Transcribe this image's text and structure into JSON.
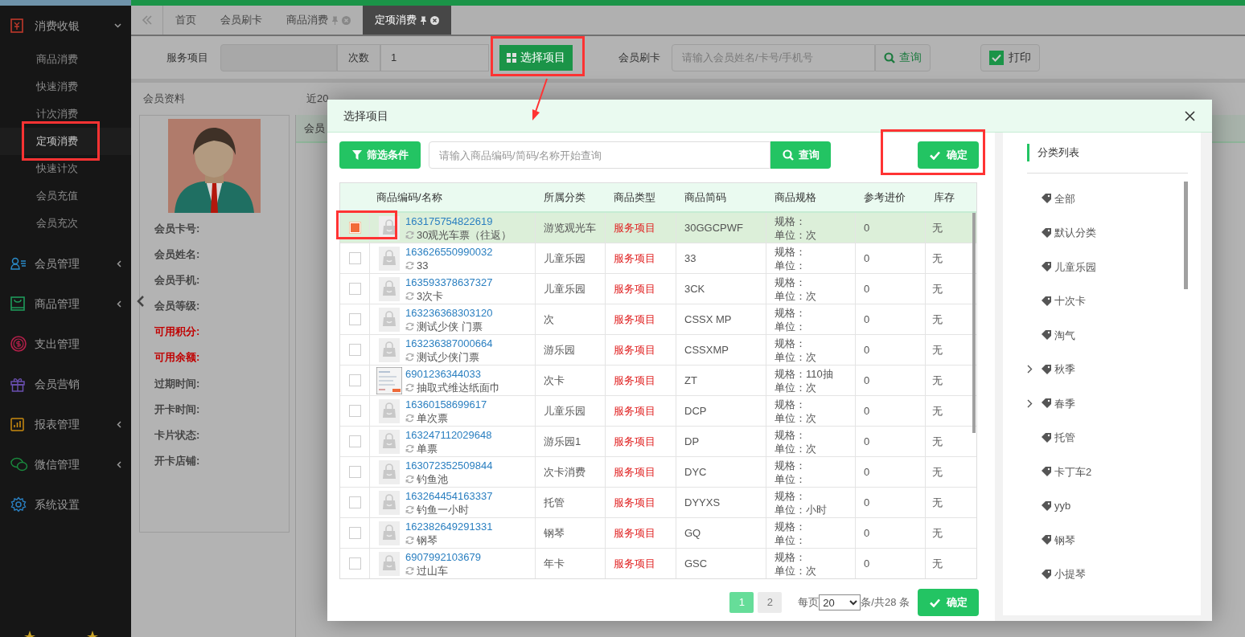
{
  "sidebar": {
    "menu": [
      {
        "label": "消费收银",
        "expanded": true,
        "children": [
          {
            "label": "商品消费",
            "selected": false
          },
          {
            "label": "快速消费",
            "selected": false
          },
          {
            "label": "计次消费",
            "selected": false
          },
          {
            "label": "定项消费",
            "selected": true
          },
          {
            "label": "快速计次",
            "selected": false
          },
          {
            "label": "会员充值",
            "selected": false
          },
          {
            "label": "会员充次",
            "selected": false
          }
        ]
      },
      {
        "label": "会员管理",
        "expanded": false
      },
      {
        "label": "商品管理",
        "expanded": false
      },
      {
        "label": "支出管理"
      },
      {
        "label": "会员营销"
      },
      {
        "label": "报表管理",
        "expanded": false
      },
      {
        "label": "微信管理",
        "expanded": false
      },
      {
        "label": "系统设置"
      }
    ]
  },
  "tabs": [
    {
      "label": "首页",
      "selected": false
    },
    {
      "label": "会员刷卡",
      "selected": false
    },
    {
      "label": "商品消费",
      "selected": false,
      "pinned": true,
      "closable": true
    },
    {
      "label": "定项消费",
      "selected": true,
      "pinned": true,
      "closable": true
    }
  ],
  "form": {
    "service_label": "服务项目",
    "count_label": "次数",
    "count_value": "1",
    "select_button": "选择项目",
    "member_label": "会员刷卡",
    "member_search": {
      "placeholder": "请输入会员姓名/卡号/手机号"
    },
    "query_button": "查询",
    "print": {
      "label": "打印",
      "checked": true
    }
  },
  "member_panel": {
    "title": "会员资料",
    "fields": [
      {
        "label": "会员卡号:",
        "emphasis": false
      },
      {
        "label": "会员姓名:",
        "emphasis": false
      },
      {
        "label": "会员手机:",
        "emphasis": false
      },
      {
        "label": "会员等级:",
        "emphasis": false
      },
      {
        "label": "可用积分:",
        "emphasis": true
      },
      {
        "label": "可用余额:",
        "emphasis": true
      },
      {
        "label": "过期时间:",
        "emphasis": false
      },
      {
        "label": "开卡时间:",
        "emphasis": false
      },
      {
        "label": "卡片状态:",
        "emphasis": false
      },
      {
        "label": "开卡店铺:",
        "emphasis": false
      }
    ]
  },
  "recent_panel": {
    "title": "近20",
    "header": "会员"
  },
  "dialog": {
    "title": "选择项目",
    "filter_button": "筛选条件",
    "search": {
      "placeholder": "请输入商品编码/简码/名称开始查询"
    },
    "query_button": "查询",
    "confirm_button": "确定",
    "table": {
      "columns": [
        "商品编码/名称",
        "所属分类",
        "商品类型",
        "商品简码",
        "商品规格",
        "参考进价",
        "库存"
      ],
      "rows": [
        {
          "selected": true,
          "kind": "placeholder",
          "code": "163175754822619",
          "name": "30观光车票（往返）",
          "category": "游览观光车",
          "type": "服务项目",
          "short_code": "30GGCPWF",
          "spec": "规格：",
          "unit": "单位：次",
          "price": "0",
          "stock": "无"
        },
        {
          "selected": false,
          "kind": "placeholder",
          "code": "163626550990032",
          "name": "33",
          "category": "儿童乐园",
          "type": "服务项目",
          "short_code": "33",
          "spec": "规格：",
          "unit": "单位：",
          "price": "0",
          "stock": "无"
        },
        {
          "selected": false,
          "kind": "placeholder",
          "code": "163593378637327",
          "name": "3次卡",
          "category": "儿童乐园",
          "type": "服务项目",
          "short_code": "3CK",
          "spec": "规格：",
          "unit": "单位：次",
          "price": "0",
          "stock": "无"
        },
        {
          "selected": false,
          "kind": "placeholder",
          "code": "163236368303120",
          "name": "测试少侠 门票",
          "category": "次",
          "type": "服务项目",
          "short_code": "CSSX MP",
          "spec": "规格：",
          "unit": "单位：",
          "price": "0",
          "stock": "无"
        },
        {
          "selected": false,
          "kind": "placeholder",
          "code": "163236387000664",
          "name": "测试少侠门票",
          "category": "游乐园",
          "type": "服务项目",
          "short_code": "CSSXMP",
          "spec": "规格：",
          "unit": "单位：次",
          "price": "0",
          "stock": "无"
        },
        {
          "selected": false,
          "kind": "picture",
          "code": "6901236344033",
          "name": "抽取式维达纸面巾",
          "category": "次卡",
          "type": "服务项目",
          "short_code": "ZT",
          "spec": "规格：110抽",
          "unit": "单位：次",
          "price": "0",
          "stock": "无"
        },
        {
          "selected": false,
          "kind": "placeholder",
          "code": "16360158699617",
          "name": "单次票",
          "category": "儿童乐园",
          "type": "服务项目",
          "short_code": "DCP",
          "spec": "规格：",
          "unit": "单位：次",
          "price": "0",
          "stock": "无"
        },
        {
          "selected": false,
          "kind": "placeholder",
          "code": "163247112029648",
          "name": "单票",
          "category": "游乐园1",
          "type": "服务项目",
          "short_code": "DP",
          "spec": "规格：",
          "unit": "单位：次",
          "price": "0",
          "stock": "无"
        },
        {
          "selected": false,
          "kind": "placeholder",
          "code": "163072352509844",
          "name": "钓鱼池",
          "category": "次卡消费",
          "type": "服务项目",
          "short_code": "DYC",
          "spec": "规格：",
          "unit": "单位：",
          "price": "0",
          "stock": "无"
        },
        {
          "selected": false,
          "kind": "placeholder",
          "code": "163264454163337",
          "name": "钓鱼一小时",
          "category": "托管",
          "type": "服务项目",
          "short_code": "DYYXS",
          "spec": "规格：",
          "unit": "单位：小时",
          "price": "0",
          "stock": "无"
        },
        {
          "selected": false,
          "kind": "placeholder",
          "code": "162382649291331",
          "name": "钢琴",
          "category": "钢琴",
          "type": "服务项目",
          "short_code": "GQ",
          "spec": "规格：",
          "unit": "单位：",
          "price": "0",
          "stock": "无"
        },
        {
          "selected": false,
          "kind": "placeholder",
          "code": "6907992103679",
          "name": "过山车",
          "category": "年卡",
          "type": "服务项目",
          "short_code": "GSC",
          "spec": "规格：",
          "unit": "单位：次",
          "price": "0",
          "stock": "无"
        }
      ]
    },
    "pagination": {
      "pages": [
        {
          "label": "1",
          "selected": true
        },
        {
          "label": "2",
          "selected": false
        }
      ],
      "per_page_label": "每页",
      "per_page_value": "20",
      "total": "条/共28 条"
    },
    "bottom_confirm": "确定",
    "categories": {
      "title": "分类列表",
      "items": [
        {
          "label": "全部"
        },
        {
          "label": "默认分类"
        },
        {
          "label": "儿童乐园"
        },
        {
          "label": "十次卡"
        },
        {
          "label": "淘气"
        },
        {
          "label": "秋季",
          "expanded": false
        },
        {
          "label": "春季",
          "expanded": false
        },
        {
          "label": "托管"
        },
        {
          "label": "卡丁车2"
        },
        {
          "label": "yyb"
        },
        {
          "label": "钢琴"
        },
        {
          "label": "小提琴"
        }
      ]
    }
  }
}
